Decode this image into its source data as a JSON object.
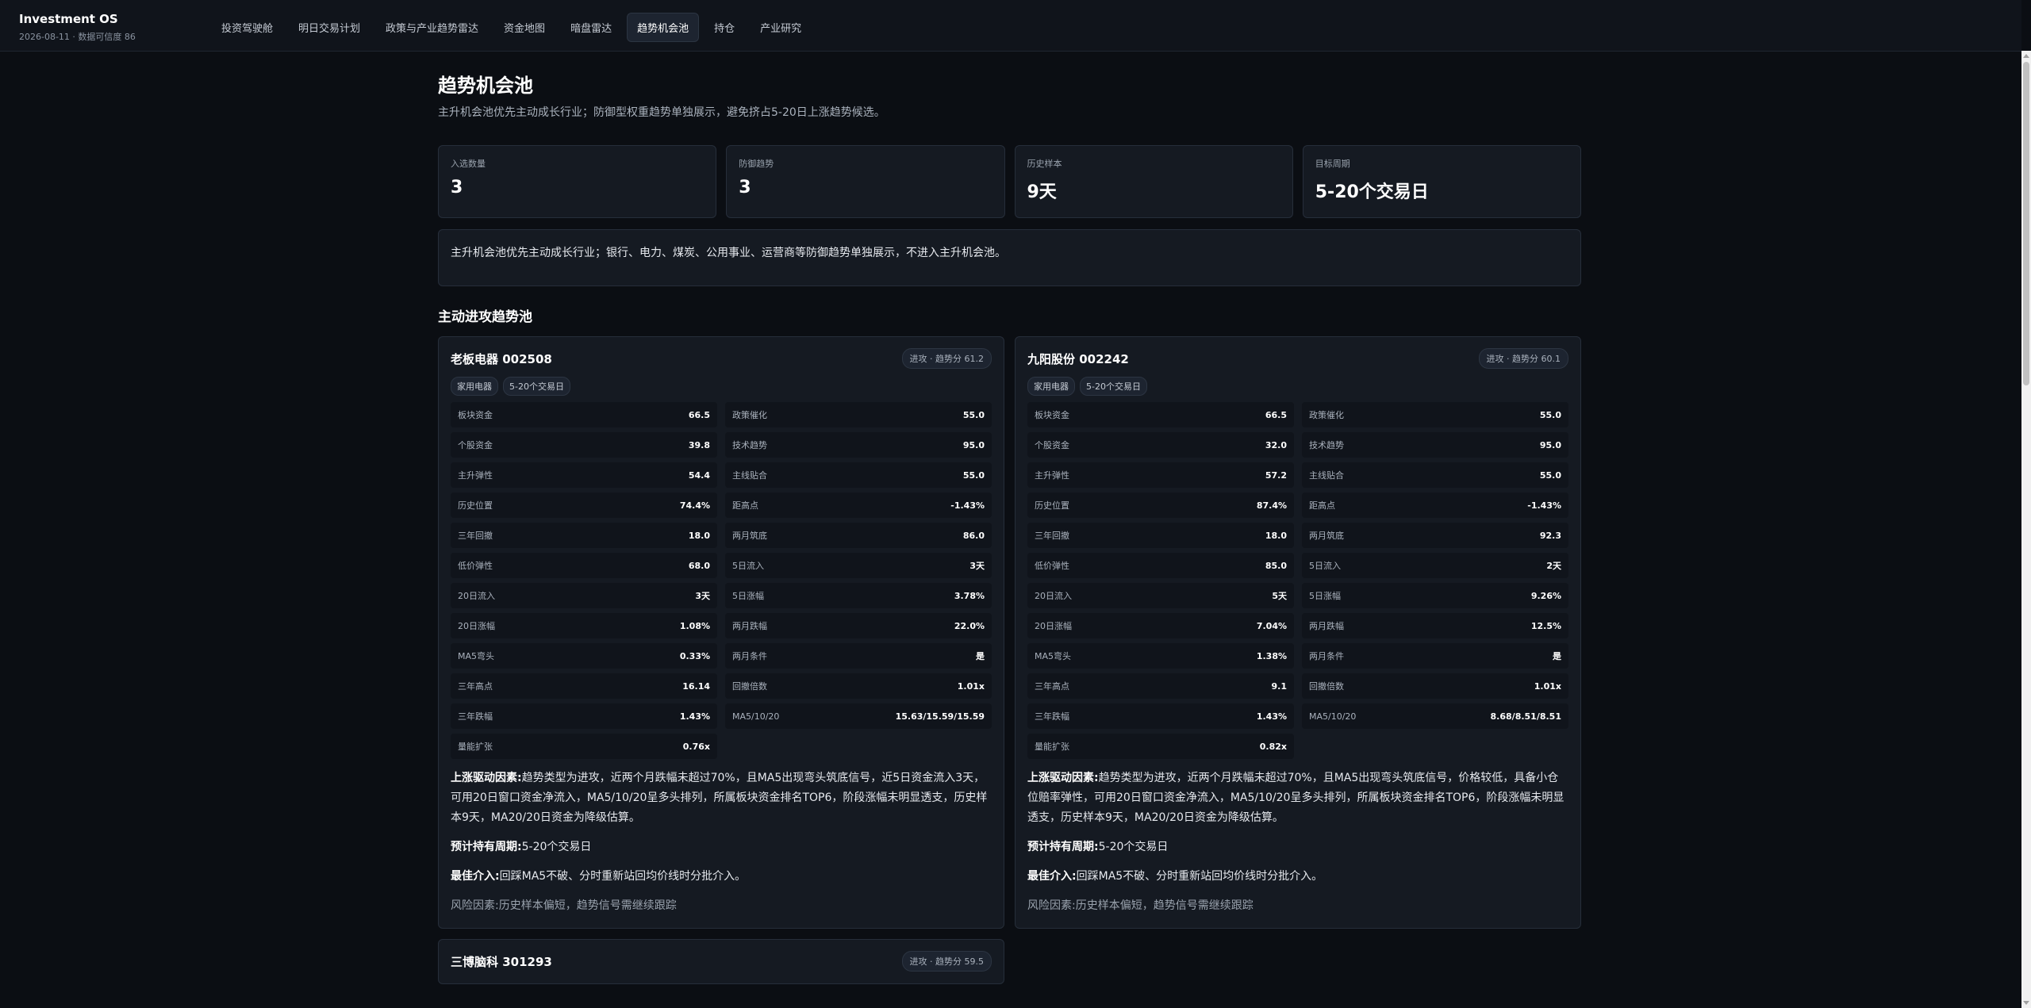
{
  "app": {
    "title": "Investment OS",
    "subtitle": "2026-08-11 · 数据可信度 86"
  },
  "nav": [
    {
      "label": "投资驾驶舱"
    },
    {
      "label": "明日交易计划"
    },
    {
      "label": "政策与产业趋势雷达"
    },
    {
      "label": "资金地图"
    },
    {
      "label": "暗盘雷达"
    },
    {
      "label": "趋势机会池",
      "active": true
    },
    {
      "label": "持仓"
    },
    {
      "label": "产业研究"
    }
  ],
  "page": {
    "title": "趋势机会池",
    "subtitle": "主升机会池优先主动成长行业；防御型权重趋势单独展示，避免挤占5-20日上涨趋势候选。"
  },
  "stats": [
    {
      "label": "入选数量",
      "value": "3"
    },
    {
      "label": "防御趋势",
      "value": "3"
    },
    {
      "label": "历史样本",
      "value": "9天"
    },
    {
      "label": "目标周期",
      "value": "5-20个交易日"
    }
  ],
  "notice": "主升机会池优先主动成长行业；银行、电力、煤炭、公用事业、运营商等防御趋势单独展示，不进入主升机会池。",
  "section_title": "主动进攻趋势池",
  "cards": [
    {
      "title": "老板电器 002508",
      "score": "进攻 · 趋势分 61.2",
      "tags": [
        "家用电器",
        "5-20个交易日"
      ],
      "metrics": [
        {
          "label": "板块资金",
          "value": "66.5"
        },
        {
          "label": "政策催化",
          "value": "55.0"
        },
        {
          "label": "个股资金",
          "value": "39.8"
        },
        {
          "label": "技术趋势",
          "value": "95.0"
        },
        {
          "label": "主升弹性",
          "value": "54.4"
        },
        {
          "label": "主线贴合",
          "value": "55.0"
        },
        {
          "label": "历史位置",
          "value": "74.4%"
        },
        {
          "label": "距高点",
          "value": "-1.43%"
        },
        {
          "label": "三年回撤",
          "value": "18.0"
        },
        {
          "label": "两月筑底",
          "value": "86.0"
        },
        {
          "label": "低价弹性",
          "value": "68.0"
        },
        {
          "label": "5日流入",
          "value": "3天"
        },
        {
          "label": "20日流入",
          "value": "3天"
        },
        {
          "label": "5日涨幅",
          "value": "3.78%"
        },
        {
          "label": "20日涨幅",
          "value": "1.08%"
        },
        {
          "label": "两月跌幅",
          "value": "22.0%"
        },
        {
          "label": "MA5弯头",
          "value": "0.33%"
        },
        {
          "label": "两月条件",
          "value": "是"
        },
        {
          "label": "三年高点",
          "value": "16.14"
        },
        {
          "label": "回撤倍数",
          "value": "1.01x"
        },
        {
          "label": "三年跌幅",
          "value": "1.43%"
        },
        {
          "label": "MA5/10/20",
          "value": "15.63/15.59/15.59"
        },
        {
          "label": "量能扩张",
          "value": "0.76x"
        }
      ],
      "driver_label": "上涨驱动因素:",
      "driver": "趋势类型为进攻，近两个月跌幅未超过70%，且MA5出现弯头筑底信号，近5日资金流入3天，可用20日窗口资金净流入，MA5/10/20呈多头排列，所属板块资金排名TOP6，阶段涨幅未明显透支，历史样本9天，MA20/20日资金为降级估算。",
      "hold_label": "预计持有周期:",
      "hold": "5-20个交易日",
      "entry_label": "最佳介入:",
      "entry": "回踩MA5不破、分时重新站回均价线时分批介入。",
      "risk_label": "风险因素:",
      "risk": "历史样本偏短，趋势信号需继续跟踪"
    },
    {
      "title": "九阳股份 002242",
      "score": "进攻 · 趋势分 60.1",
      "tags": [
        "家用电器",
        "5-20个交易日"
      ],
      "metrics": [
        {
          "label": "板块资金",
          "value": "66.5"
        },
        {
          "label": "政策催化",
          "value": "55.0"
        },
        {
          "label": "个股资金",
          "value": "32.0"
        },
        {
          "label": "技术趋势",
          "value": "95.0"
        },
        {
          "label": "主升弹性",
          "value": "57.2"
        },
        {
          "label": "主线贴合",
          "value": "55.0"
        },
        {
          "label": "历史位置",
          "value": "87.4%"
        },
        {
          "label": "距高点",
          "value": "-1.43%"
        },
        {
          "label": "三年回撤",
          "value": "18.0"
        },
        {
          "label": "两月筑底",
          "value": "92.3"
        },
        {
          "label": "低价弹性",
          "value": "85.0"
        },
        {
          "label": "5日流入",
          "value": "2天"
        },
        {
          "label": "20日流入",
          "value": "5天"
        },
        {
          "label": "5日涨幅",
          "value": "9.26%"
        },
        {
          "label": "20日涨幅",
          "value": "7.04%"
        },
        {
          "label": "两月跌幅",
          "value": "12.5%"
        },
        {
          "label": "MA5弯头",
          "value": "1.38%"
        },
        {
          "label": "两月条件",
          "value": "是"
        },
        {
          "label": "三年高点",
          "value": "9.1"
        },
        {
          "label": "回撤倍数",
          "value": "1.01x"
        },
        {
          "label": "三年跌幅",
          "value": "1.43%"
        },
        {
          "label": "MA5/10/20",
          "value": "8.68/8.51/8.51"
        },
        {
          "label": "量能扩张",
          "value": "0.82x"
        }
      ],
      "driver_label": "上涨驱动因素:",
      "driver": "趋势类型为进攻，近两个月跌幅未超过70%，且MA5出现弯头筑底信号，价格较低，具备小仓位赔率弹性，可用20日窗口资金净流入，MA5/10/20呈多头排列，所属板块资金排名TOP6，阶段涨幅未明显透支，历史样本9天，MA20/20日资金为降级估算。",
      "hold_label": "预计持有周期:",
      "hold": "5-20个交易日",
      "entry_label": "最佳介入:",
      "entry": "回踩MA5不破、分时重新站回均价线时分批介入。",
      "risk_label": "风险因素:",
      "risk": "历史样本偏短，趋势信号需继续跟踪"
    },
    {
      "title": "三博脑科 301293",
      "score": "进攻 · 趋势分 59.5",
      "tags": [],
      "metrics": []
    }
  ]
}
